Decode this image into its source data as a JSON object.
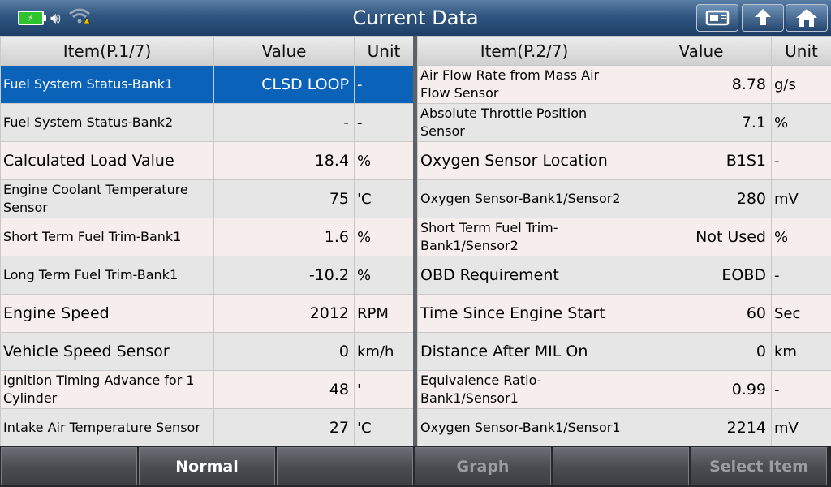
{
  "header": {
    "title": "Current Data",
    "buttons": [
      "print-icon",
      "back-icon",
      "home-icon"
    ]
  },
  "left_table": {
    "headers": {
      "item": "Item(P.1/7)",
      "value": "Value",
      "unit": "Unit"
    },
    "rows": [
      {
        "item": "Fuel System Status-Bank1",
        "value": "CLSD LOOP",
        "unit": "-"
      },
      {
        "item": "Fuel System Status-Bank2",
        "value": "-",
        "unit": "-"
      },
      {
        "item": "Calculated Load Value",
        "value": "18.4",
        "unit": "%"
      },
      {
        "item": "Engine Coolant Temperature Sensor",
        "value": "75",
        "unit": "'C"
      },
      {
        "item": "Short Term Fuel Trim-Bank1",
        "value": "1.6",
        "unit": "%"
      },
      {
        "item": "Long Term Fuel Trim-Bank1",
        "value": "-10.2",
        "unit": "%"
      },
      {
        "item": "Engine Speed",
        "value": "2012",
        "unit": "RPM"
      },
      {
        "item": "Vehicle Speed Sensor",
        "value": "0",
        "unit": "km/h"
      },
      {
        "item": "Ignition Timing Advance for 1 Cylinder",
        "value": "48",
        "unit": "'"
      },
      {
        "item": "Intake Air Temperature Sensor",
        "value": "27",
        "unit": "'C"
      }
    ]
  },
  "right_table": {
    "headers": {
      "item": "Item(P.2/7)",
      "value": "Value",
      "unit": "Unit"
    },
    "rows": [
      {
        "item": "Air Flow Rate from Mass Air Flow Sensor",
        "value": "8.78",
        "unit": "g/s"
      },
      {
        "item": "Absolute Throttle Position Sensor",
        "value": "7.1",
        "unit": "%"
      },
      {
        "item": "Oxygen Sensor Location",
        "value": "B1S1",
        "unit": "-"
      },
      {
        "item": "Oxygen Sensor-Bank1/Sensor2",
        "value": "280",
        "unit": "mV"
      },
      {
        "item": "Short Term Fuel Trim-Bank1/Sensor2",
        "value": "Not Used",
        "unit": "%"
      },
      {
        "item": "OBD Requirement",
        "value": "EOBD",
        "unit": "-"
      },
      {
        "item": "Time Since Engine Start",
        "value": "60",
        "unit": "Sec"
      },
      {
        "item": "Distance After MIL On",
        "value": "0",
        "unit": "km"
      },
      {
        "item": "Equivalence Ratio-Bank1/Sensor1",
        "value": "0.99",
        "unit": "-"
      },
      {
        "item": "Oxygen Sensor-Bank1/Sensor1",
        "value": "2214",
        "unit": "mV"
      }
    ]
  },
  "bottom_bar": {
    "buttons": [
      {
        "label": ""
      },
      {
        "label": "Normal"
      },
      {
        "label": ""
      },
      {
        "label": "Graph"
      },
      {
        "label": ""
      },
      {
        "label": "Select Item"
      }
    ]
  },
  "colors": {
    "selected_row": "#0a63b8",
    "header_bar": "#2f5580"
  }
}
